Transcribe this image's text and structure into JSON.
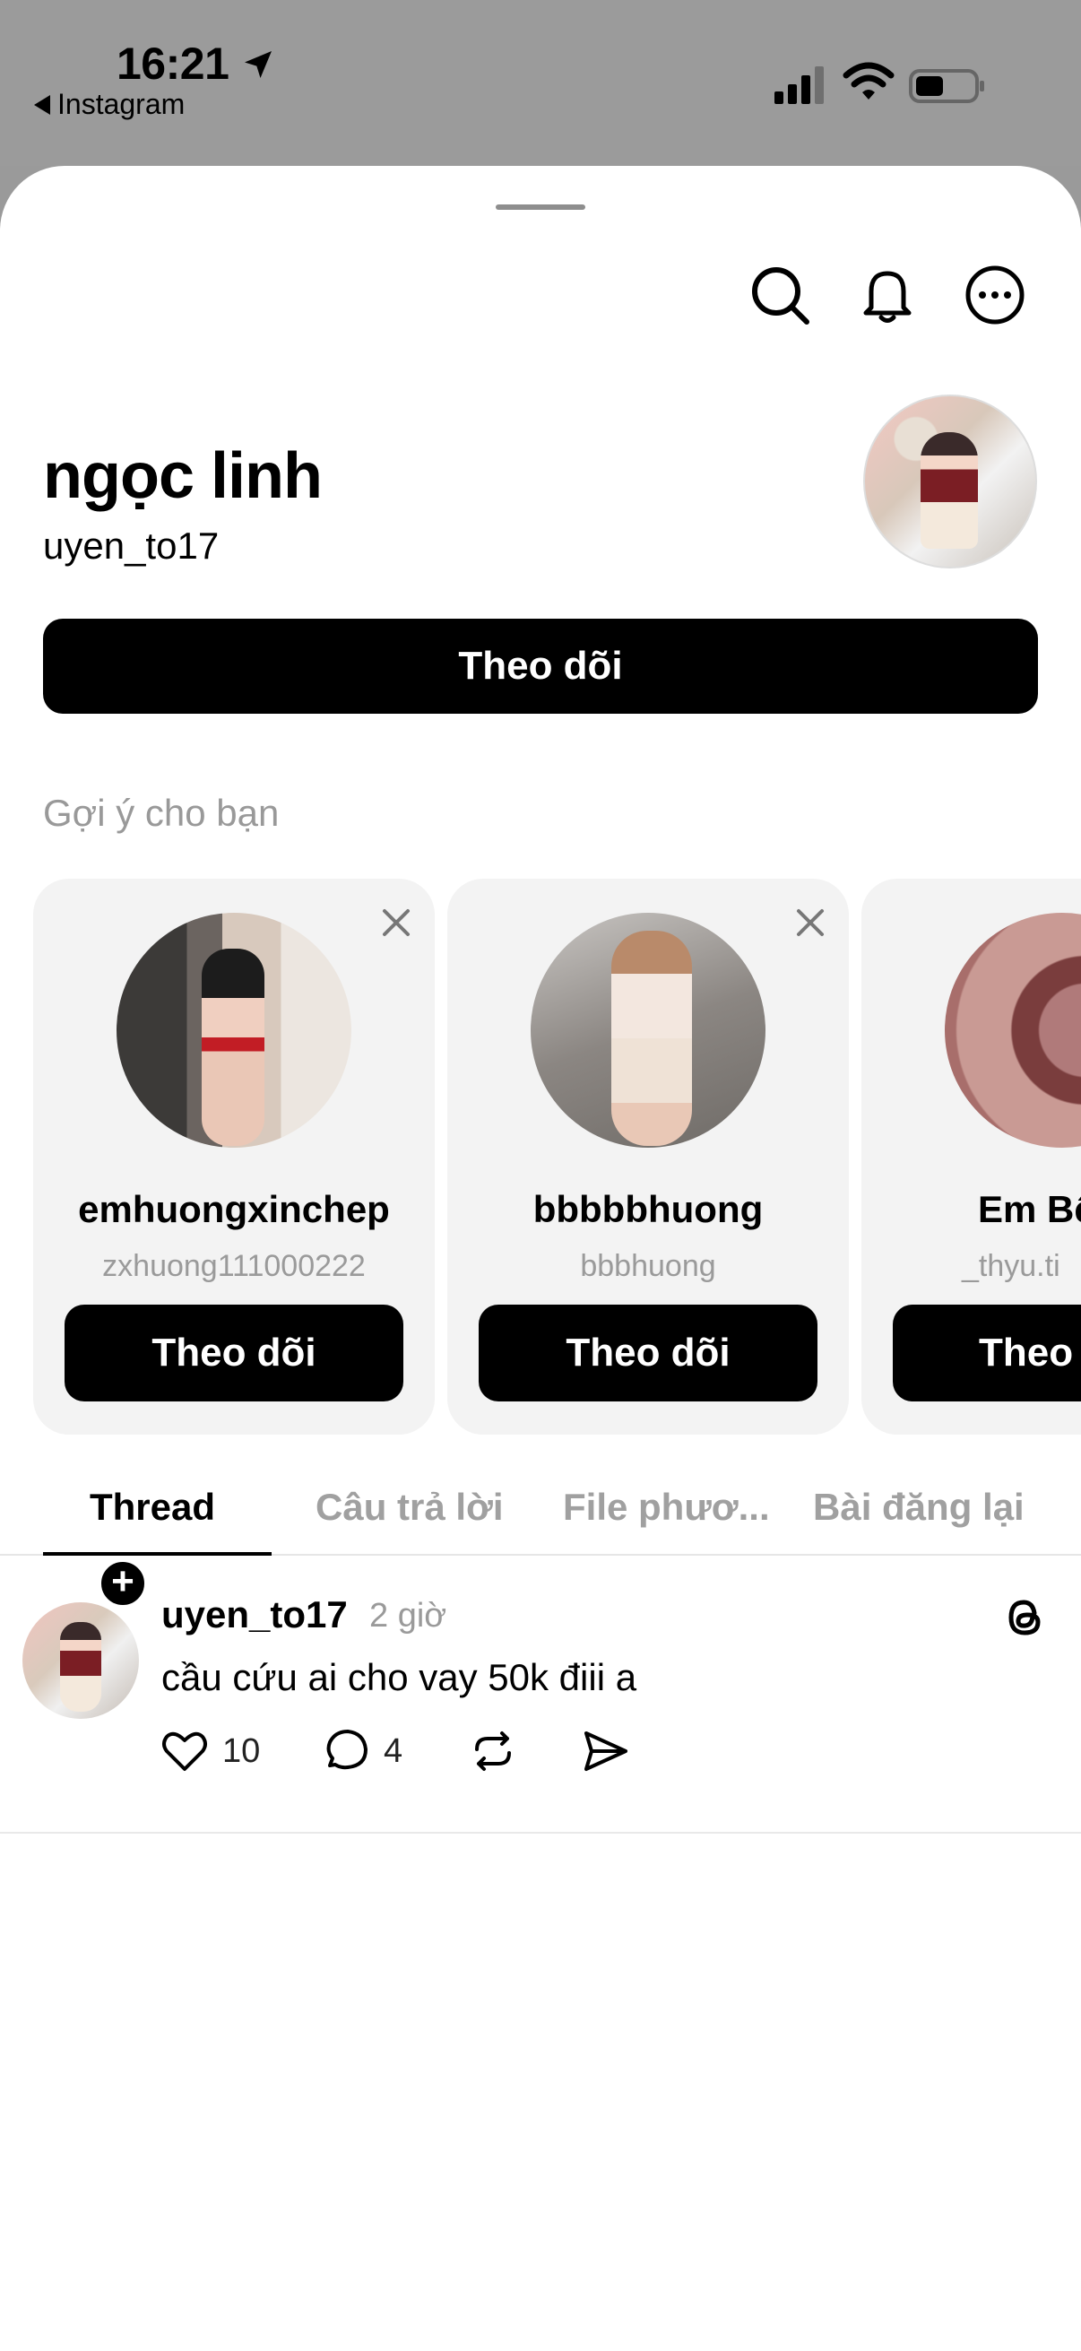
{
  "status_bar": {
    "time": "16:21",
    "back_app": "Instagram"
  },
  "profile": {
    "name": "ngọc linh",
    "handle": "uyen_to17",
    "follow_label": "Theo dõi"
  },
  "suggestions": {
    "title": "Gợi ý cho bạn",
    "cards": [
      {
        "name": "emhuongxinchep",
        "handle": "zxhuong111000222",
        "follow_label": "Theo dõi"
      },
      {
        "name": "bbbbbhuong",
        "handle": "bbbhuong",
        "follow_label": "Theo dõi"
      },
      {
        "name": "Em Bê",
        "handle": "_thyu.ti",
        "follow_label": "Theo"
      }
    ]
  },
  "tabs": [
    {
      "label": "Thread"
    },
    {
      "label": "Câu trả lời"
    },
    {
      "label": "File phươ..."
    },
    {
      "label": "Bài đăng lại"
    }
  ],
  "post": {
    "user": "uyen_to17",
    "time": "2 giờ",
    "text": "cầu cứu ai cho vay 50k điii a",
    "likes": "10",
    "comments": "4"
  },
  "icons": {
    "search": "search-icon",
    "bell": "bell-icon",
    "more": "more-icon",
    "close": "close-icon",
    "heart": "heart-icon",
    "comment": "comment-icon",
    "repost": "repost-icon",
    "share": "send-icon",
    "threads": "threads-logo-icon"
  }
}
